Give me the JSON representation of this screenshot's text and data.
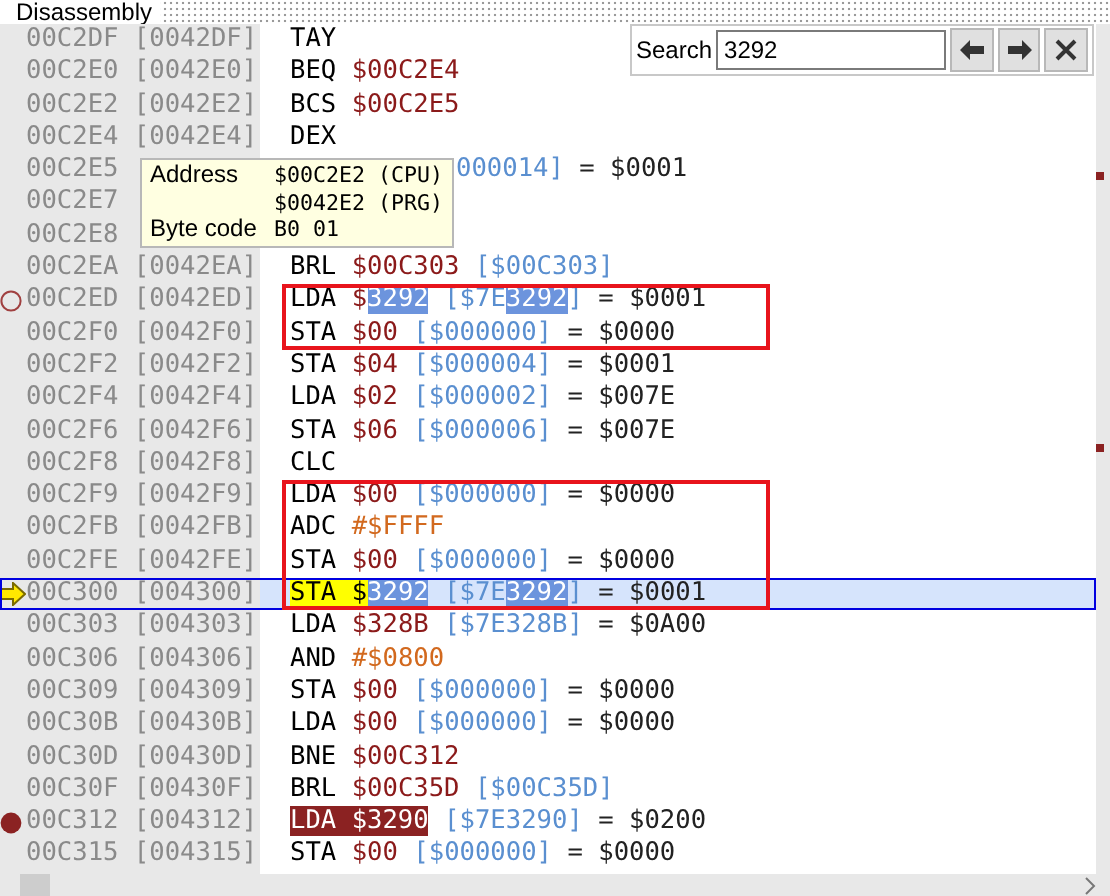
{
  "panel": {
    "title": "Disassembly"
  },
  "search": {
    "label": "Search",
    "value": "3292",
    "buttons": [
      {
        "kind": "prev"
      },
      {
        "kind": "next"
      },
      {
        "kind": "close"
      }
    ]
  },
  "tooltip": {
    "rows": [
      {
        "label": "Address",
        "value": "$00C2E2 (CPU)"
      },
      {
        "value": "$0042E2 (PRG)"
      },
      {
        "label": "Byte code",
        "value": "B0 01"
      }
    ]
  },
  "lines": [
    {
      "kind": "line",
      "address": "00C2DF",
      "offset": "[0042DF]",
      "breakpoint": false,
      "selected": false,
      "code": [
        {
          "kind": "op",
          "text": "TAY"
        }
      ]
    },
    {
      "kind": "line",
      "address": "00C2E0",
      "offset": "[0042E0]",
      "breakpoint": false,
      "selected": false,
      "code": [
        {
          "kind": "op",
          "text": "BEQ "
        },
        {
          "kind": "addr",
          "text": "$00C2E4"
        }
      ]
    },
    {
      "kind": "line",
      "address": "00C2E2",
      "offset": "[0042E2]",
      "breakpoint": false,
      "selected": false,
      "code": [
        {
          "kind": "op",
          "text": "BCS "
        },
        {
          "kind": "addr",
          "text": "$00C2E5"
        }
      ]
    },
    {
      "kind": "line",
      "address": "00C2E4",
      "offset": "[0042E4]",
      "breakpoint": false,
      "selected": false,
      "code": [
        {
          "kind": "op",
          "text": "DEX"
        }
      ]
    },
    {
      "kind": "line",
      "address": "00C2E5",
      "breakpoint": false,
      "selected": false,
      "covered": true,
      "code": [
        {
          "kind": "eff",
          "text": "000014]"
        },
        {
          "kind": "val",
          "text": " = $0001"
        }
      ]
    },
    {
      "kind": "line",
      "address": "00C2E7",
      "breakpoint": false,
      "selected": false
    },
    {
      "kind": "line",
      "address": "00C2E8",
      "breakpoint": false,
      "selected": false
    },
    {
      "kind": "line",
      "address": "00C2EA",
      "offset": "[0042EA]",
      "breakpoint": false,
      "selected": false,
      "code": [
        {
          "kind": "op",
          "text": "BRL "
        },
        {
          "kind": "addr",
          "text": "$00C303"
        },
        {
          "kind": "eff",
          "text": " [$00C303]"
        }
      ]
    },
    {
      "kind": "group",
      "lines": [
        {
          "address": "00C2ED",
          "offset": "[0042ED]",
          "breakpoint": true,
          "enabled": false,
          "selected": false,
          "code": [
            {
              "kind": "op",
              "text": "LDA "
            },
            {
              "kind": "addr",
              "text": "$"
            },
            {
              "kind": "match",
              "text": "3292"
            },
            {
              "kind": "eff",
              "text": " [$7E"
            },
            {
              "kind": "match",
              "text": "3292"
            },
            {
              "kind": "eff",
              "text": "]"
            },
            {
              "kind": "val",
              "text": " = $0001"
            }
          ]
        },
        {
          "address": "00C2F0",
          "offset": "[0042F0]",
          "breakpoint": false,
          "selected": false,
          "code": [
            {
              "kind": "op",
              "text": "STA "
            },
            {
              "kind": "addr",
              "text": "$00"
            },
            {
              "kind": "eff",
              "text": " [$000000]"
            },
            {
              "kind": "val",
              "text": " = $0000"
            }
          ]
        }
      ]
    },
    {
      "kind": "line",
      "address": "00C2F2",
      "offset": "[0042F2]",
      "breakpoint": false,
      "selected": false,
      "code": [
        {
          "kind": "op",
          "text": "STA "
        },
        {
          "kind": "addr",
          "text": "$04"
        },
        {
          "kind": "eff",
          "text": " [$000004]"
        },
        {
          "kind": "val",
          "text": " = $0001"
        }
      ]
    },
    {
      "kind": "line",
      "address": "00C2F4",
      "offset": "[0042F4]",
      "breakpoint": false,
      "selected": false,
      "code": [
        {
          "kind": "op",
          "text": "LDA "
        },
        {
          "kind": "addr",
          "text": "$02"
        },
        {
          "kind": "eff",
          "text": " [$000002]"
        },
        {
          "kind": "val",
          "text": " = $007E"
        }
      ]
    },
    {
      "kind": "line",
      "address": "00C2F6",
      "offset": "[0042F6]",
      "breakpoint": false,
      "selected": false,
      "code": [
        {
          "kind": "op",
          "text": "STA "
        },
        {
          "kind": "addr",
          "text": "$06"
        },
        {
          "kind": "eff",
          "text": " [$000006]"
        },
        {
          "kind": "val",
          "text": " = $007E"
        }
      ]
    },
    {
      "kind": "line",
      "address": "00C2F8",
      "offset": "[0042F8]",
      "breakpoint": false,
      "selected": false,
      "code": [
        {
          "kind": "op",
          "text": "CLC"
        }
      ]
    },
    {
      "kind": "group",
      "lines": [
        {
          "address": "00C2F9",
          "offset": "[0042F9]",
          "breakpoint": false,
          "selected": false,
          "code": [
            {
              "kind": "op",
              "text": "LDA "
            },
            {
              "kind": "addr",
              "text": "$00"
            },
            {
              "kind": "eff",
              "text": " [$000000]"
            },
            {
              "kind": "val",
              "text": " = $0000"
            }
          ]
        },
        {
          "address": "00C2FB",
          "offset": "[0042FB]",
          "breakpoint": false,
          "selected": false,
          "code": [
            {
              "kind": "op",
              "text": "ADC "
            },
            {
              "kind": "imm",
              "text": "#$FFFF"
            }
          ]
        },
        {
          "address": "00C2FE",
          "offset": "[0042FE]",
          "breakpoint": false,
          "selected": false,
          "code": [
            {
              "kind": "op",
              "text": "STA "
            },
            {
              "kind": "addr",
              "text": "$00"
            },
            {
              "kind": "eff",
              "text": " [$000000]"
            },
            {
              "kind": "val",
              "text": " = $0000"
            }
          ]
        },
        {
          "address": "00C300",
          "offset": "[004300]",
          "breakpoint": false,
          "selected": true,
          "code": [
            {
              "kind": "current",
              "text": "STA $"
            },
            {
              "kind": "match",
              "text": "3292"
            },
            {
              "kind": "eff",
              "text": " [$7E"
            },
            {
              "kind": "match",
              "text": "3292"
            },
            {
              "kind": "eff",
              "text": "]"
            },
            {
              "kind": "val",
              "text": " = $0001"
            }
          ]
        }
      ]
    },
    {
      "kind": "line",
      "address": "00C303",
      "offset": "[004303]",
      "breakpoint": false,
      "selected": false,
      "code": [
        {
          "kind": "op",
          "text": "LDA "
        },
        {
          "kind": "addr",
          "text": "$328B"
        },
        {
          "kind": "eff",
          "text": " [$7E328B]"
        },
        {
          "kind": "val",
          "text": " = $0A00"
        }
      ]
    },
    {
      "kind": "line",
      "address": "00C306",
      "offset": "[004306]",
      "breakpoint": false,
      "selected": false,
      "code": [
        {
          "kind": "op",
          "text": "AND "
        },
        {
          "kind": "imm",
          "text": "#$0800"
        }
      ]
    },
    {
      "kind": "line",
      "address": "00C309",
      "offset": "[004309]",
      "breakpoint": false,
      "selected": false,
      "code": [
        {
          "kind": "op",
          "text": "STA "
        },
        {
          "kind": "addr",
          "text": "$00"
        },
        {
          "kind": "eff",
          "text": " [$000000]"
        },
        {
          "kind": "val",
          "text": " = $0000"
        }
      ]
    },
    {
      "kind": "line",
      "address": "00C30B",
      "offset": "[00430B]",
      "breakpoint": false,
      "selected": false,
      "code": [
        {
          "kind": "op",
          "text": "LDA "
        },
        {
          "kind": "addr",
          "text": "$00"
        },
        {
          "kind": "eff",
          "text": " [$000000]"
        },
        {
          "kind": "val",
          "text": " = $0000"
        }
      ]
    },
    {
      "kind": "line",
      "address": "00C30D",
      "offset": "[00430D]",
      "breakpoint": false,
      "selected": false,
      "code": [
        {
          "kind": "op",
          "text": "BNE "
        },
        {
          "kind": "addr",
          "text": "$00C312"
        }
      ]
    },
    {
      "kind": "line",
      "address": "00C30F",
      "offset": "[00430F]",
      "breakpoint": false,
      "selected": false,
      "code": [
        {
          "kind": "op",
          "text": "BRL "
        },
        {
          "kind": "addr",
          "text": "$00C35D"
        },
        {
          "kind": "eff",
          "text": " [$00C35D]"
        }
      ]
    },
    {
      "kind": "line",
      "address": "00C312",
      "offset": "[004312]",
      "breakpoint": true,
      "enabled": true,
      "selected": false,
      "code": [
        {
          "kind": "bp",
          "text": "LDA $3290"
        },
        {
          "kind": "eff",
          "text": " [$7E3290]"
        },
        {
          "kind": "val",
          "text": " = $0200"
        }
      ]
    },
    {
      "kind": "line",
      "address": "00C315",
      "offset": "[004315]",
      "breakpoint": false,
      "selected": false,
      "code": [
        {
          "kind": "op",
          "text": "STA "
        },
        {
          "kind": "addr",
          "text": "$00"
        },
        {
          "kind": "eff",
          "text": " [$000000]"
        },
        {
          "kind": "val",
          "text": " = $0000"
        }
      ]
    }
  ]
}
